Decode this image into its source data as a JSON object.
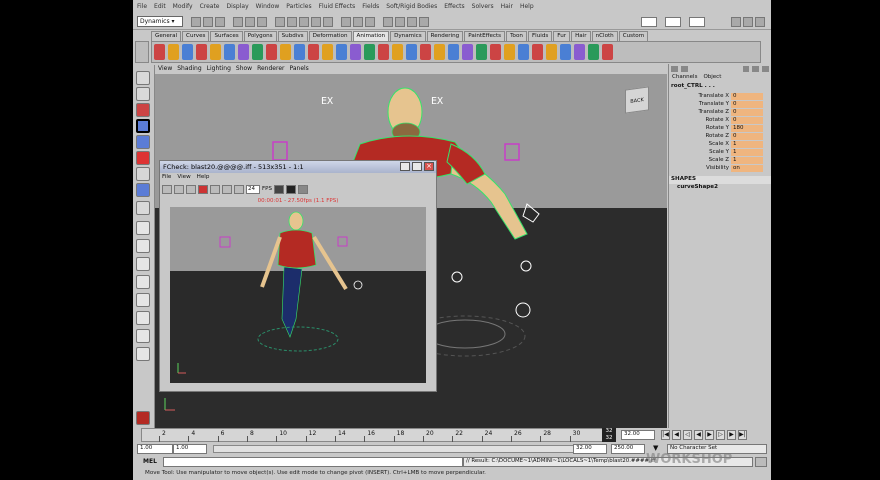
{
  "app": {
    "menus": [
      "File",
      "Edit",
      "Modify",
      "Create",
      "Display",
      "Window",
      "Particles",
      "Fluid Effects",
      "Fields",
      "Soft/Rigid Bodies",
      "Effects",
      "Solvers",
      "Hair",
      "Help"
    ],
    "mode": "Dynamics"
  },
  "shelf": {
    "tabs": [
      "General",
      "Curves",
      "Surfaces",
      "Polygons",
      "Subdivs",
      "Deformation",
      "Animation",
      "Dynamics",
      "Rendering",
      "PaintEffects",
      "Toon",
      "Fluids",
      "Fur",
      "Hair",
      "nCloth",
      "Custom"
    ],
    "active": "Animation"
  },
  "viewport": {
    "menus": [
      "View",
      "Shading",
      "Lighting",
      "Show",
      "Renderer",
      "Panels"
    ],
    "viewcube_label": "BACK",
    "camera_label": "EX"
  },
  "channelbox": {
    "tabs": [
      "Channels",
      "Object"
    ],
    "node": "root_CTRL . . .",
    "attrs": [
      {
        "name": "Translate X",
        "value": "0"
      },
      {
        "name": "Translate Y",
        "value": "0"
      },
      {
        "name": "Translate Z",
        "value": "0"
      },
      {
        "name": "Rotate X",
        "value": "0"
      },
      {
        "name": "Rotate Y",
        "value": "180"
      },
      {
        "name": "Rotate Z",
        "value": "0"
      },
      {
        "name": "Scale X",
        "value": "1"
      },
      {
        "name": "Scale Y",
        "value": "1"
      },
      {
        "name": "Scale Z",
        "value": "1"
      },
      {
        "name": "Visibility",
        "value": "on"
      }
    ],
    "shapes_header": "SHAPES",
    "shape": "curveShape2"
  },
  "fcheck": {
    "title": "FCheck: blast20.@@@@.iff - 513x351 - 1:1",
    "menus": [
      "File",
      "View",
      "Help"
    ],
    "fps_value": "24",
    "fps_label": "FPS",
    "overlay": "00:00:01 - 27.50fps (1.1 FPS)"
  },
  "timeline": {
    "ticks": [
      "2",
      "4",
      "6",
      "8",
      "10",
      "12",
      "14",
      "16",
      "18",
      "20",
      "22",
      "24",
      "26",
      "28",
      "30"
    ],
    "current": "32",
    "end": "32",
    "current_field": "32.00"
  },
  "range": {
    "start": "1.00",
    "start2": "1.00",
    "end_field": "32.00",
    "end2": "250.00",
    "charset": "No Character Set"
  },
  "cmd": {
    "label": "MEL",
    "result": "// Result: C:\\DOCUME~1\\ADMINI~1\\LOCALS~1\\Temp\\blast20.####.iff"
  },
  "help": {
    "text": "Move Tool: Use manipulator to move object(s). Use edit mode to change pivot (INSERT). Ctrl+LMB to move perpendicular."
  },
  "watermark": "WORKSHOP",
  "colors": {
    "ui_gray": "#c8c8c8",
    "viewport_bg": "#9a9a9a",
    "floor": "#2c2c2c",
    "channel_value": "#efb57f",
    "character_shirt": "#b42a23",
    "selection_green": "#37e36b",
    "control_magenta": "#c83ec8"
  }
}
